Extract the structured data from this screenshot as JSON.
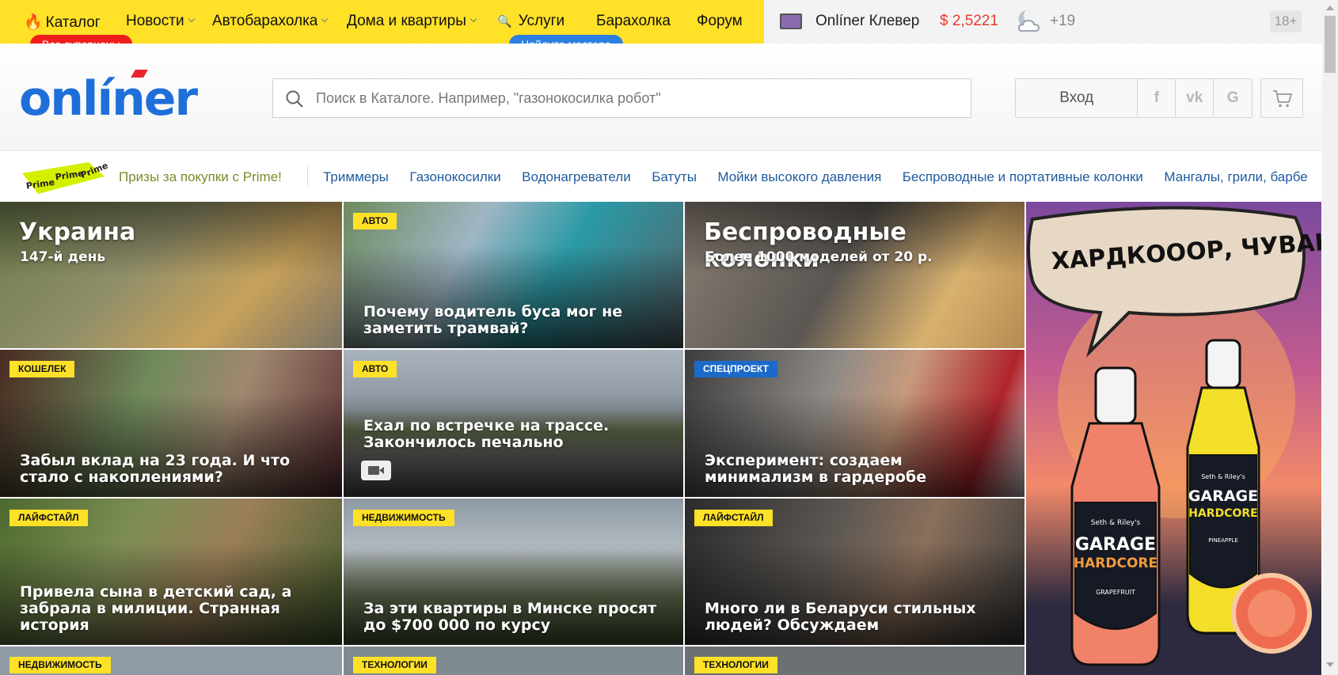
{
  "topnav": {
    "items": [
      {
        "label": "Каталог",
        "icon": "fire-icon"
      },
      {
        "label": "Новости"
      },
      {
        "label": "Автобарахолка"
      },
      {
        "label": "Дома и квартиры"
      },
      {
        "label": "Услуги",
        "icon": "magnifier-icon"
      },
      {
        "label": "Барахолка"
      },
      {
        "label": "Форум"
      }
    ],
    "pill_catalog": "Все суперцены",
    "pill_services": "Найдите мастера",
    "clever": "Onlíner Клевер",
    "currency": "$ 2,5221",
    "temperature": "+19",
    "age_rating": "18+"
  },
  "header": {
    "logo": "onlíner",
    "search_placeholder": "Поиск в Каталоге. Например, \"газонокосилка робот\"",
    "login": "Вход",
    "social": [
      "f",
      "vk",
      "G"
    ]
  },
  "prime_strip": {
    "badge": "Prime",
    "promo": "Призы за покупки с Prime!",
    "links": [
      "Триммеры",
      "Газонокосилки",
      "Водонагреватели",
      "Батуты",
      "Мойки высокого давления",
      "Беспроводные и портативные колонки",
      "Мангалы, грили, барбе"
    ]
  },
  "news": [
    {
      "title": "Украина",
      "subtitle": "147-й день",
      "tag": ""
    },
    {
      "title": "Почему водитель буса мог не заметить трамвай?",
      "tag": "АВТО"
    },
    {
      "title": "Беспроводные колонки",
      "subtitle": "Более 1000 моделей от 20 р.",
      "tag": ""
    },
    {
      "title": "Забыл вклад на 23 года. И что стало с накоплениями?",
      "tag": "КОШЕЛЕК"
    },
    {
      "title": "Ехал по встречке на трассе. Закончилось печально",
      "tag": "АВТО"
    },
    {
      "title": "Эксперимент: создаем минимализм в гардеробе",
      "tag": "СПЕЦПРОЕКТ"
    },
    {
      "title": "Привела сына в детский сад, а забрала в милиции. Странная история",
      "tag": "ЛАЙФСТАЙЛ"
    },
    {
      "title": "За эти квартиры в Минске просят до $700 000 по курсу",
      "tag": "НЕДВИЖИМОСТЬ"
    },
    {
      "title": "Много ли в Беларуси стильных людей? Обсуждаем",
      "tag": "ЛАЙФСТАЙЛ"
    },
    {
      "title": "",
      "tag": "НЕДВИЖИМОСТЬ"
    },
    {
      "title": "",
      "tag": "ТЕХНОЛОГИИ"
    },
    {
      "title": "",
      "tag": "ТЕХНОЛОГИИ"
    }
  ],
  "ad": {
    "headline": "ХАРДКОООР, ЧУВАК!",
    "brand_line1": "Seth & Riley's",
    "brand_line2": "GARAGE",
    "brand_line3": "HARDCORE",
    "flavor_left": "GRAPEFRUIT",
    "flavor_right": "PINEAPPLE"
  },
  "colors": {
    "brand_yellow": "#ffe127",
    "brand_blue": "#1e6fd9",
    "accent_red": "#e8242f",
    "link_blue": "#1e5a9f"
  }
}
